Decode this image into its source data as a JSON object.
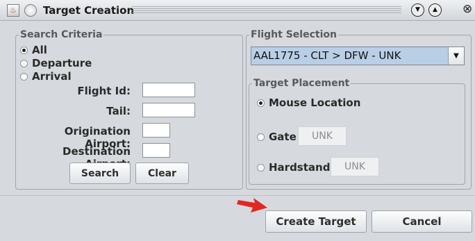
{
  "window": {
    "title": "Target Creation"
  },
  "search_criteria": {
    "legend": "Search Criteria",
    "radios": [
      {
        "label": "All",
        "selected": true
      },
      {
        "label": "Departure",
        "selected": false
      },
      {
        "label": "Arrival",
        "selected": false
      }
    ],
    "fields": {
      "flight_id": {
        "label": "Flight Id:",
        "value": ""
      },
      "tail": {
        "label": "Tail:",
        "value": ""
      },
      "origination": {
        "label": "Origination Airport:",
        "value": ""
      },
      "destination": {
        "label": "Destination Airport:",
        "value": ""
      }
    },
    "search_label": "Search",
    "clear_label": "Clear"
  },
  "flight_selection": {
    "legend": "Flight Selection",
    "selected_flight": "AAL1775 - CLT > DFW - UNK"
  },
  "target_placement": {
    "legend": "Target Placement",
    "options": {
      "mouse": {
        "label": "Mouse Location",
        "selected": true
      },
      "gate": {
        "label": "Gate",
        "selected": false,
        "value": "UNK"
      },
      "hardstand": {
        "label": "Hardstand",
        "selected": false,
        "value": "UNK"
      }
    }
  },
  "actions": {
    "create_label": "Create Target",
    "cancel_label": "Cancel"
  },
  "icons": {
    "app": "java-app-icon",
    "pin": "window-menu-icon",
    "minimize": "chevron-down-icon",
    "maximize": "chevron-up-icon",
    "close": "close-icon",
    "dropdown": "dropdown-arrow-icon",
    "pointer": "red-arrow-icon"
  },
  "colors": {
    "selection": "#b8cfe6",
    "pointer": "#e52620"
  }
}
